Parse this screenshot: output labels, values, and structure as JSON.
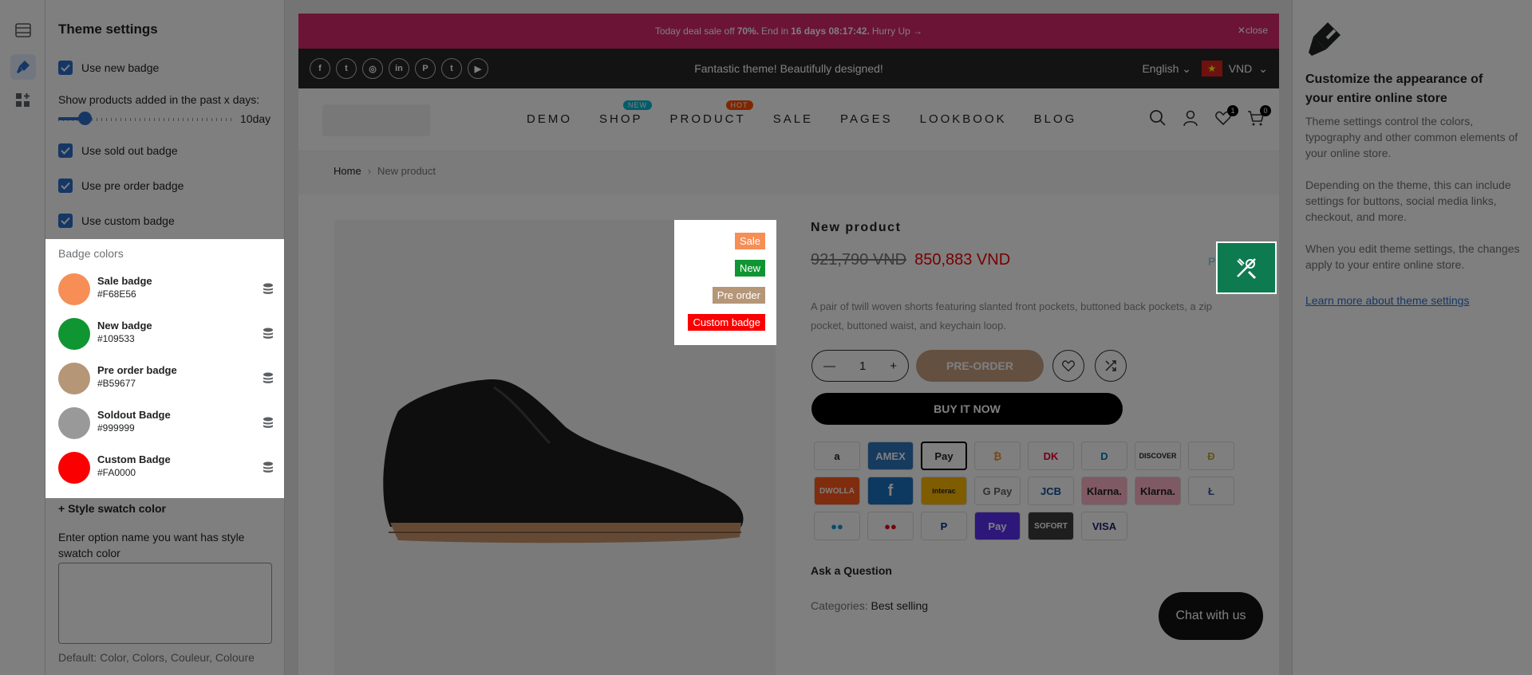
{
  "settings": {
    "title": "Theme settings",
    "use_new_badge": "Use new badge",
    "past_days_label": "Show products added in the past x days:",
    "past_days_value": "10day",
    "past_days_fraction": 0.15,
    "use_sold_out": "Use sold out badge",
    "use_pre_order": "Use pre order badge",
    "use_custom": "Use custom badge",
    "badge_colors_title": "Badge colors",
    "badges": [
      {
        "name": "Sale badge",
        "hex": "#F68E56"
      },
      {
        "name": "New badge",
        "hex": "#109533"
      },
      {
        "name": "Pre order badge",
        "hex": "#B59677"
      },
      {
        "name": "Soldout Badge",
        "hex": "#999999"
      },
      {
        "name": "Custom Badge",
        "hex": "#FA0000"
      }
    ],
    "style_swatch": "+ Style swatch color",
    "option_label": "Enter option name you want has style swatch color",
    "option_default": "Default: Color, Colors, Couleur, Coloure"
  },
  "store": {
    "promo_pre": "Today deal sale off",
    "promo_pct": "70%.",
    "promo_mid": "End in",
    "promo_time": "16 days 08:17:42.",
    "promo_post": "Hurry Up →",
    "promo_close": "close",
    "tagline": "Fantastic theme! Beautifully designed!",
    "language": "English",
    "currency": "VND",
    "menu": [
      {
        "label": "DEMO",
        "tag": ""
      },
      {
        "label": "SHOP",
        "tag": "NEW"
      },
      {
        "label": "PRODUCT",
        "tag": "HOT"
      },
      {
        "label": "SALE",
        "tag": ""
      },
      {
        "label": "PAGES",
        "tag": ""
      },
      {
        "label": "LOOKBOOK",
        "tag": ""
      },
      {
        "label": "BLOG",
        "tag": ""
      }
    ],
    "wishlist_count": "1",
    "cart_count": "0",
    "breadcrumb_home": "Home",
    "breadcrumb_current": "New product",
    "badge_preview": [
      "Sale",
      "New",
      "Pre order",
      "Custom badge"
    ],
    "product_name": "New product",
    "old_price": "921,790 VND",
    "new_price": "850,883 VND",
    "pre_link": "Pre",
    "description": "A pair of twill woven shorts featuring slanted front pockets, buttoned back pockets, a zip pocket, buttoned waist, and keychain loop.",
    "qty": "1",
    "preorder": "PRE-ORDER",
    "buy_now": "BUY IT NOW",
    "payments": [
      "a",
      "AMEX",
      "Pay",
      "₿",
      "DK",
      "D",
      "DISCOVER",
      "Ð",
      "DWOLLA",
      "f",
      "interac",
      "G Pay",
      "JCB",
      "Klarna.",
      "Klarna.",
      "Ł",
      "●●",
      "●●",
      "P",
      "Pay",
      "SOFORT",
      "VISA"
    ],
    "ask": "Ask a Question",
    "categories_label": "Categories:",
    "categories_value": "Best selling",
    "chat": "Chat with us"
  },
  "help": {
    "title": "Customize the appearance of your entire online store",
    "p1": "Theme settings control the colors, typography and other common elements of your online store.",
    "p2": "Depending on the theme, this can include settings for buttons, social media links, checkout, and more.",
    "p3": "When you edit theme settings, the changes apply to your entire online store.",
    "link": "Learn more about theme settings"
  }
}
